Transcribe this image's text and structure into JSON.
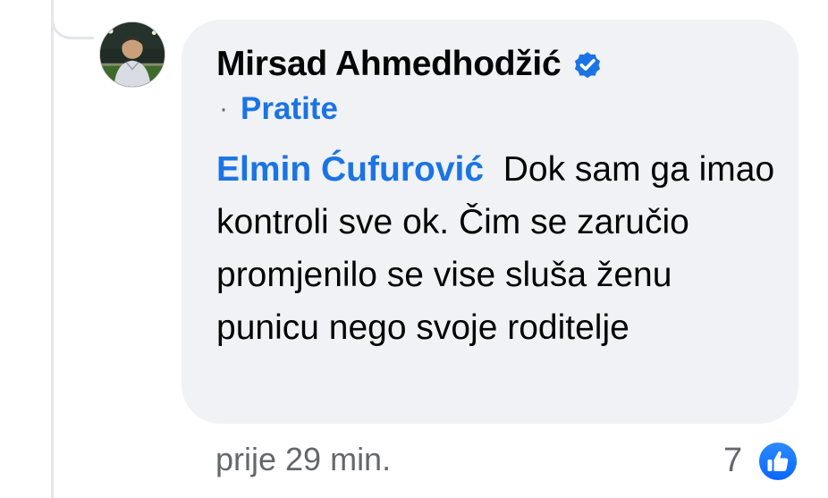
{
  "comment": {
    "author": {
      "name": "Mirsad Ahmedhodžić",
      "verified_icon": "verified-badge-icon",
      "avatar_icon": "avatar-photo"
    },
    "follow": {
      "separator": "·",
      "label": "Pratite"
    },
    "mention": "Elmin Ćufurović",
    "text": "  Dok sam ga imao kontroli sve ok. Čim se zaručio  promjenilo se vise sluša ženu punicu nego svoje roditelje",
    "timestamp": "prije 29 min.",
    "reactions": {
      "count": "7",
      "icon": "like-reaction-icon"
    }
  },
  "colors": {
    "bubble": "#f0f2f5",
    "link": "#1b74e4",
    "secondary_text": "#65676b",
    "primary_text": "#050505"
  }
}
